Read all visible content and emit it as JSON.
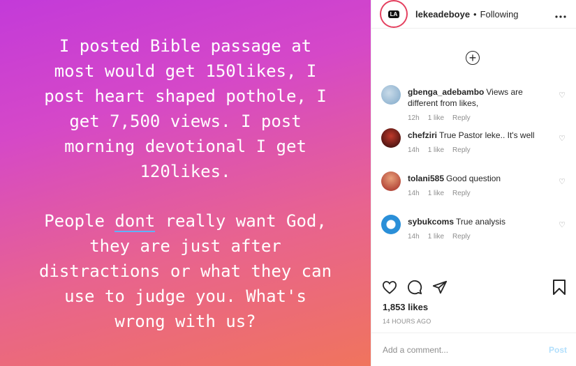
{
  "media": {
    "paragraph1": "I posted Bible passage at\nmost would get 150likes, I\npost heart shaped pothole, I\nget 7,500 views. I post\nmorning devotional I get\n120likes.",
    "p2_before": "People ",
    "p2_underlined": "dont",
    "p2_after": " really want God,\nthey are just after\ndistractions or what they can\nuse to judge you. What's\nwrong with us?",
    "gradient": [
      "#c33ad9",
      "#f0745d"
    ]
  },
  "header": {
    "avatar_text": "LA",
    "username": "lekeadeboye",
    "separator": "•",
    "follow_status": "Following",
    "more_icon": "more-horizontal-icon"
  },
  "load_more_icon": "plus-circle-icon",
  "comments": [
    {
      "user": "gbenga_adebambo",
      "text": "Views are different from likes,",
      "time": "12h",
      "likes": "1 like",
      "reply": "Reply",
      "avatar_color": "#7fa8c9"
    },
    {
      "user": "chefziri",
      "text": "True Pastor leke.. It's well",
      "time": "14h",
      "likes": "1 like",
      "reply": "Reply",
      "avatar_color": "#5a1a1a"
    },
    {
      "user": "tolani585",
      "text": "Good question",
      "time": "14h",
      "likes": "1 like",
      "reply": "Reply",
      "avatar_color": "#b0302a"
    },
    {
      "user": "sybukcoms",
      "text": "True analysis",
      "time": "14h",
      "likes": "1 like",
      "reply": "Reply",
      "avatar_color": "#2a8fd8"
    }
  ],
  "actions": {
    "like_icon": "heart-icon",
    "comment_icon": "comment-icon",
    "share_icon": "share-icon",
    "save_icon": "bookmark-icon"
  },
  "likes_count": "1,853 likes",
  "timestamp": "14 HOURS AGO",
  "add_comment": {
    "placeholder": "Add a comment...",
    "post_label": "Post"
  }
}
